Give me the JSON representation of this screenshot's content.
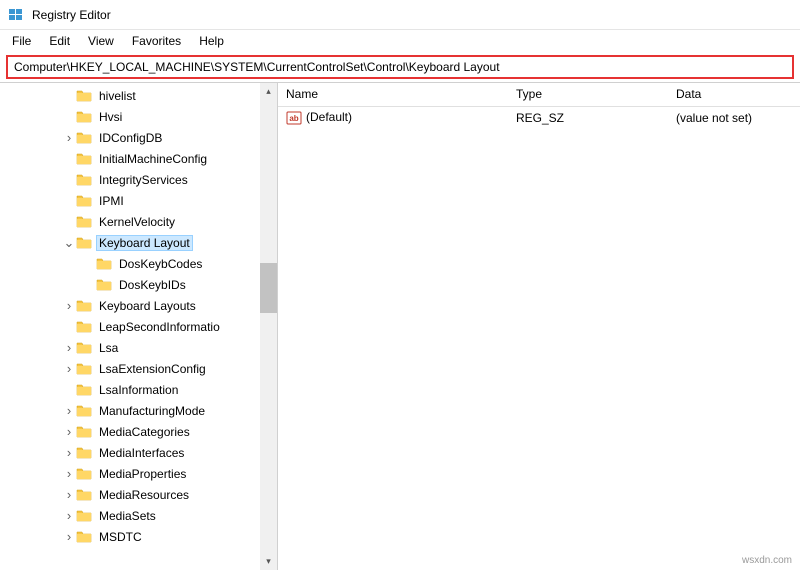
{
  "window": {
    "title": "Registry Editor"
  },
  "menu": {
    "items": [
      "File",
      "Edit",
      "View",
      "Favorites",
      "Help"
    ]
  },
  "address": {
    "path": "Computer\\HKEY_LOCAL_MACHINE\\SYSTEM\\CurrentControlSet\\Control\\Keyboard Layout"
  },
  "tree": {
    "nodes": [
      {
        "label": "hivelist",
        "exp": "",
        "indent": 1
      },
      {
        "label": "Hvsi",
        "exp": "",
        "indent": 1
      },
      {
        "label": "IDConfigDB",
        "exp": ">",
        "indent": 1
      },
      {
        "label": "InitialMachineConfig",
        "exp": "",
        "indent": 1
      },
      {
        "label": "IntegrityServices",
        "exp": "",
        "indent": 1
      },
      {
        "label": "IPMI",
        "exp": "",
        "indent": 1
      },
      {
        "label": "KernelVelocity",
        "exp": "",
        "indent": 1
      },
      {
        "label": "Keyboard Layout",
        "exp": "v",
        "indent": 1,
        "selected": true
      },
      {
        "label": "DosKeybCodes",
        "exp": "",
        "indent": 2
      },
      {
        "label": "DosKeybIDs",
        "exp": "",
        "indent": 2
      },
      {
        "label": "Keyboard Layouts",
        "exp": ">",
        "indent": 1
      },
      {
        "label": "LeapSecondInformatio",
        "exp": "",
        "indent": 1
      },
      {
        "label": "Lsa",
        "exp": ">",
        "indent": 1
      },
      {
        "label": "LsaExtensionConfig",
        "exp": ">",
        "indent": 1
      },
      {
        "label": "LsaInformation",
        "exp": "",
        "indent": 1
      },
      {
        "label": "ManufacturingMode",
        "exp": ">",
        "indent": 1
      },
      {
        "label": "MediaCategories",
        "exp": ">",
        "indent": 1
      },
      {
        "label": "MediaInterfaces",
        "exp": ">",
        "indent": 1
      },
      {
        "label": "MediaProperties",
        "exp": ">",
        "indent": 1
      },
      {
        "label": "MediaResources",
        "exp": ">",
        "indent": 1
      },
      {
        "label": "MediaSets",
        "exp": ">",
        "indent": 1
      },
      {
        "label": "MSDTC",
        "exp": ">",
        "indent": 1
      }
    ]
  },
  "list": {
    "columns": {
      "name": "Name",
      "type": "Type",
      "data": "Data"
    },
    "rows": [
      {
        "name": "(Default)",
        "type": "REG_SZ",
        "data": "(value not set)"
      }
    ]
  },
  "watermark": "wsxdn.com"
}
